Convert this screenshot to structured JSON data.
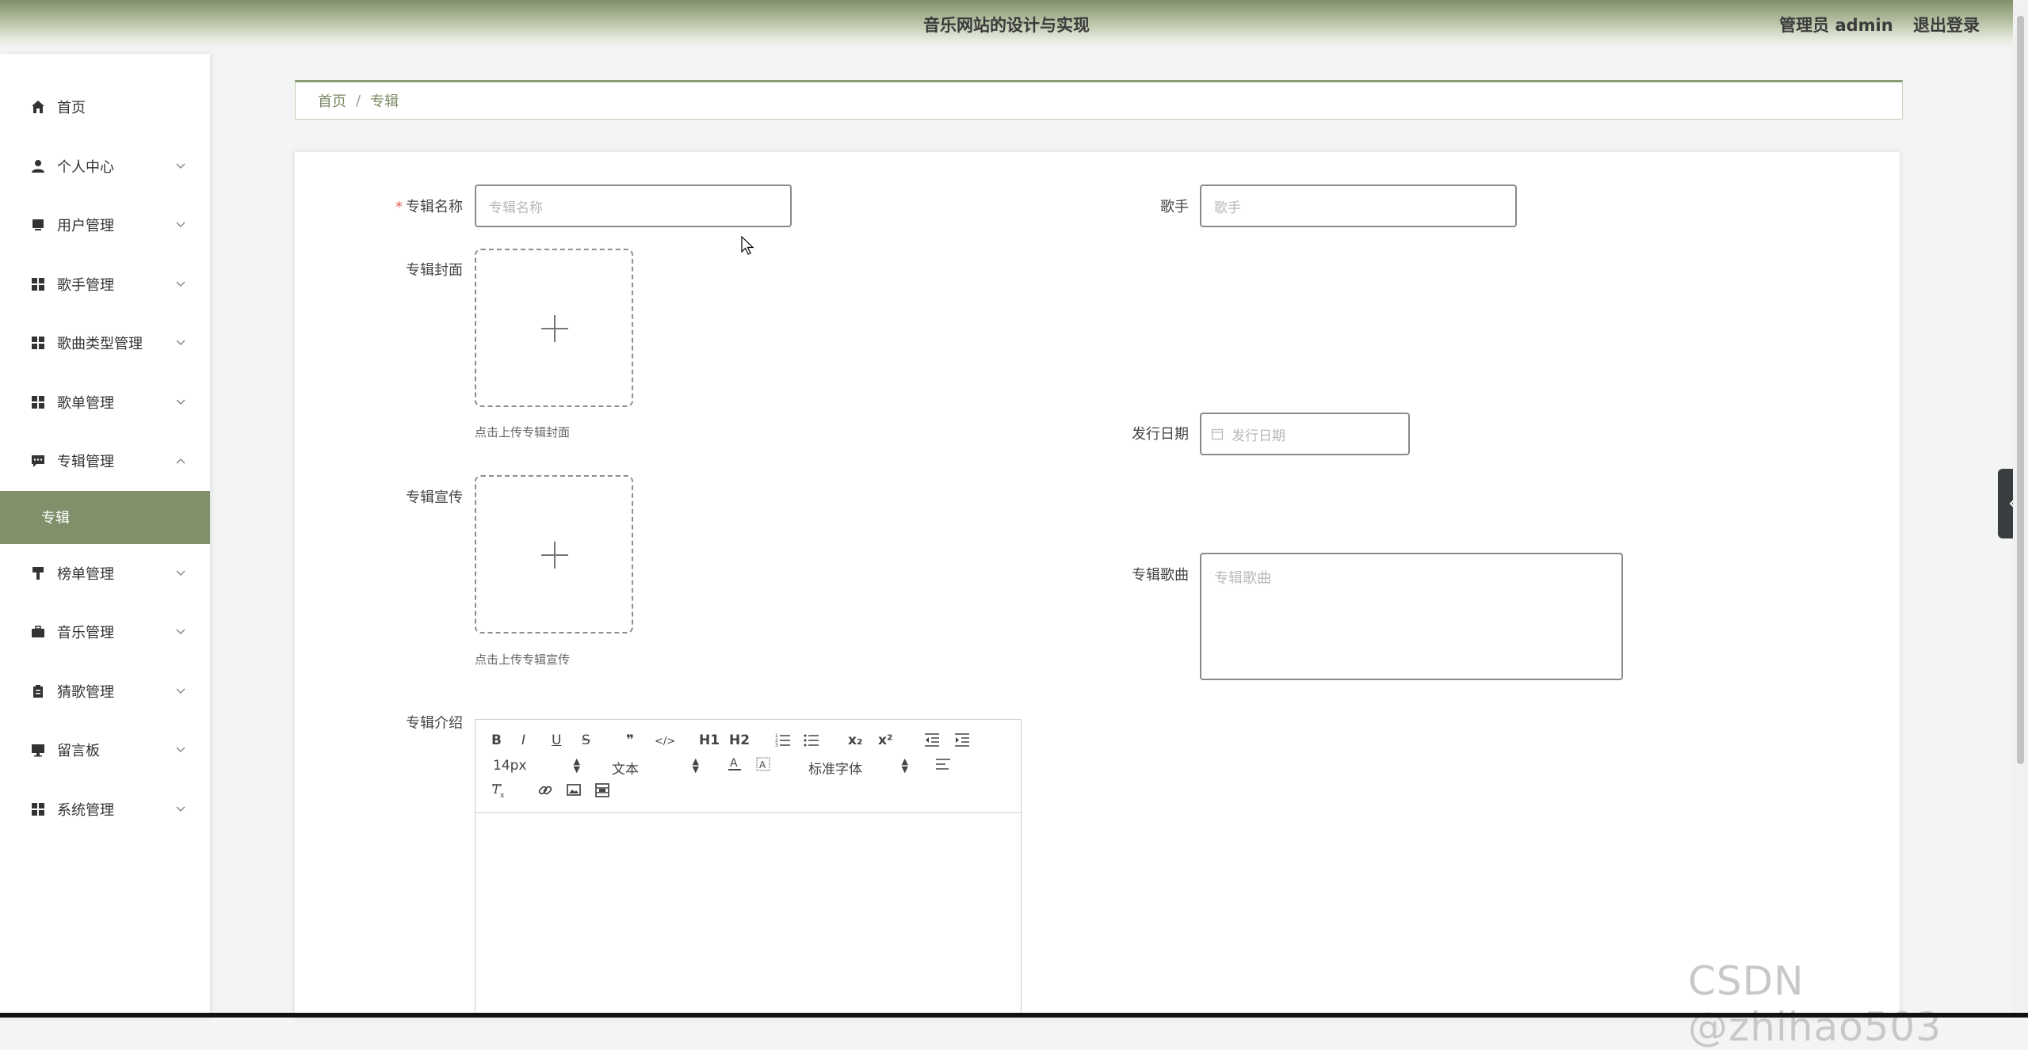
{
  "header": {
    "title": "音乐网站的设计与实现",
    "user_role": "管理员 admin",
    "logout": "退出登录"
  },
  "sidebar": {
    "items": [
      {
        "label": "首页",
        "icon": "home-icon"
      },
      {
        "label": "个人中心",
        "icon": "user-icon"
      },
      {
        "label": "用户管理",
        "icon": "monitor-icon"
      },
      {
        "label": "歌手管理",
        "icon": "grid-icon"
      },
      {
        "label": "歌曲类型管理",
        "icon": "grid-icon"
      },
      {
        "label": "歌单管理",
        "icon": "grid-icon"
      },
      {
        "label": "专辑管理",
        "icon": "chat-icon"
      },
      {
        "label": "榜单管理",
        "icon": "brush-icon"
      },
      {
        "label": "音乐管理",
        "icon": "briefcase-icon"
      },
      {
        "label": "猜歌管理",
        "icon": "clipboard-icon"
      },
      {
        "label": "留言板",
        "icon": "desktop-icon"
      },
      {
        "label": "系统管理",
        "icon": "grid-icon"
      }
    ],
    "active_sub": "专辑"
  },
  "breadcrumb": {
    "home": "首页",
    "sep": "/",
    "current": "专辑"
  },
  "form": {
    "required_mark": "*",
    "album_name_label": "专辑名称",
    "album_name_placeholder": "专辑名称",
    "singer_label": "歌手",
    "singer_placeholder": "歌手",
    "cover_label": "专辑封面",
    "cover_hint": "点击上传专辑封面",
    "release_date_label": "发行日期",
    "release_date_placeholder": "发行日期",
    "promo_label": "专辑宣传",
    "promo_hint": "点击上传专辑宣传",
    "songs_label": "专辑歌曲",
    "songs_placeholder": "专辑歌曲",
    "intro_label": "专辑介绍"
  },
  "editor": {
    "font_size": "14px",
    "header_select": "文本",
    "font_family": "标准字体",
    "buttons": [
      "B",
      "I",
      "U",
      "S",
      "❞",
      "</>",
      "H1",
      "H2",
      "ordered-list",
      "bullet-list",
      "x₂",
      "x²",
      "outdent",
      "indent"
    ]
  },
  "watermark": "CSDN @zhihao503",
  "colors": {
    "accent": "#7f906a",
    "required": "#e45a5a"
  }
}
